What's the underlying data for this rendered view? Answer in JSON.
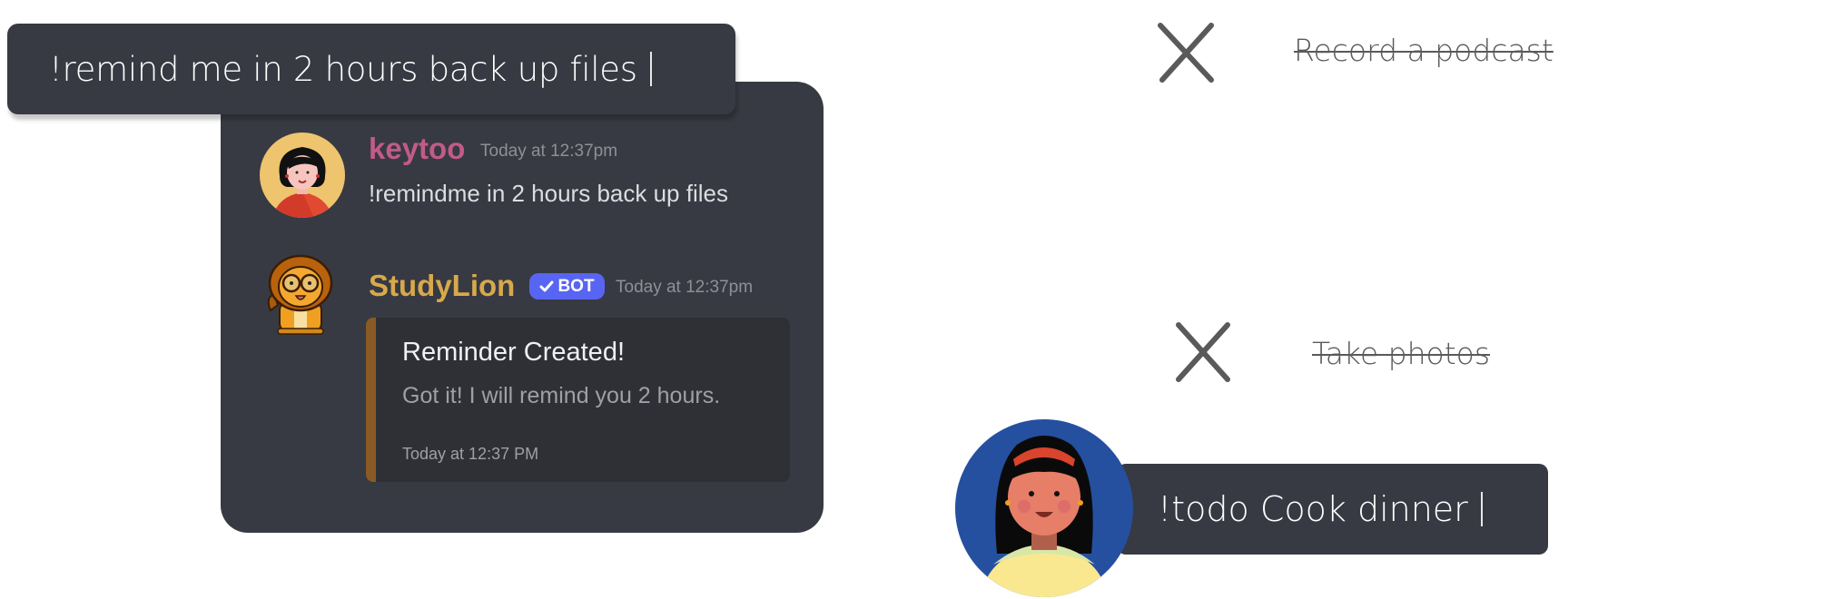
{
  "remind_input": {
    "value": "!remind me in 2 hours back up files"
  },
  "chat": {
    "messages": [
      {
        "author": "keytoo",
        "author_color": "#c25a8a",
        "timestamp": "Today at 12:37pm",
        "text": "!remindme in 2 hours back up files",
        "avatar": "woman-avatar-icon"
      },
      {
        "author": "StudyLion",
        "author_color": "#d8a94c",
        "badge": "BOT",
        "timestamp": "Today at 12:37pm",
        "avatar": "lion-avatar-icon",
        "embed": {
          "title": "Reminder Created!",
          "description": "Got it! I will remind you 2 hours.",
          "footer": "Today at 12:37 PM",
          "accent_color": "#8a5a24"
        }
      }
    ],
    "badge_color": "#5865f2"
  },
  "todo_items": [
    {
      "label": "Record a podcast",
      "status": "crossed-out",
      "icon": "x-icon"
    },
    {
      "label": "Take photos",
      "status": "crossed-out",
      "icon": "x-icon"
    }
  ],
  "todo_input": {
    "value": "!todo Cook dinner"
  },
  "colors": {
    "panel": "#373a42",
    "embed_bg": "#2e3035"
  }
}
